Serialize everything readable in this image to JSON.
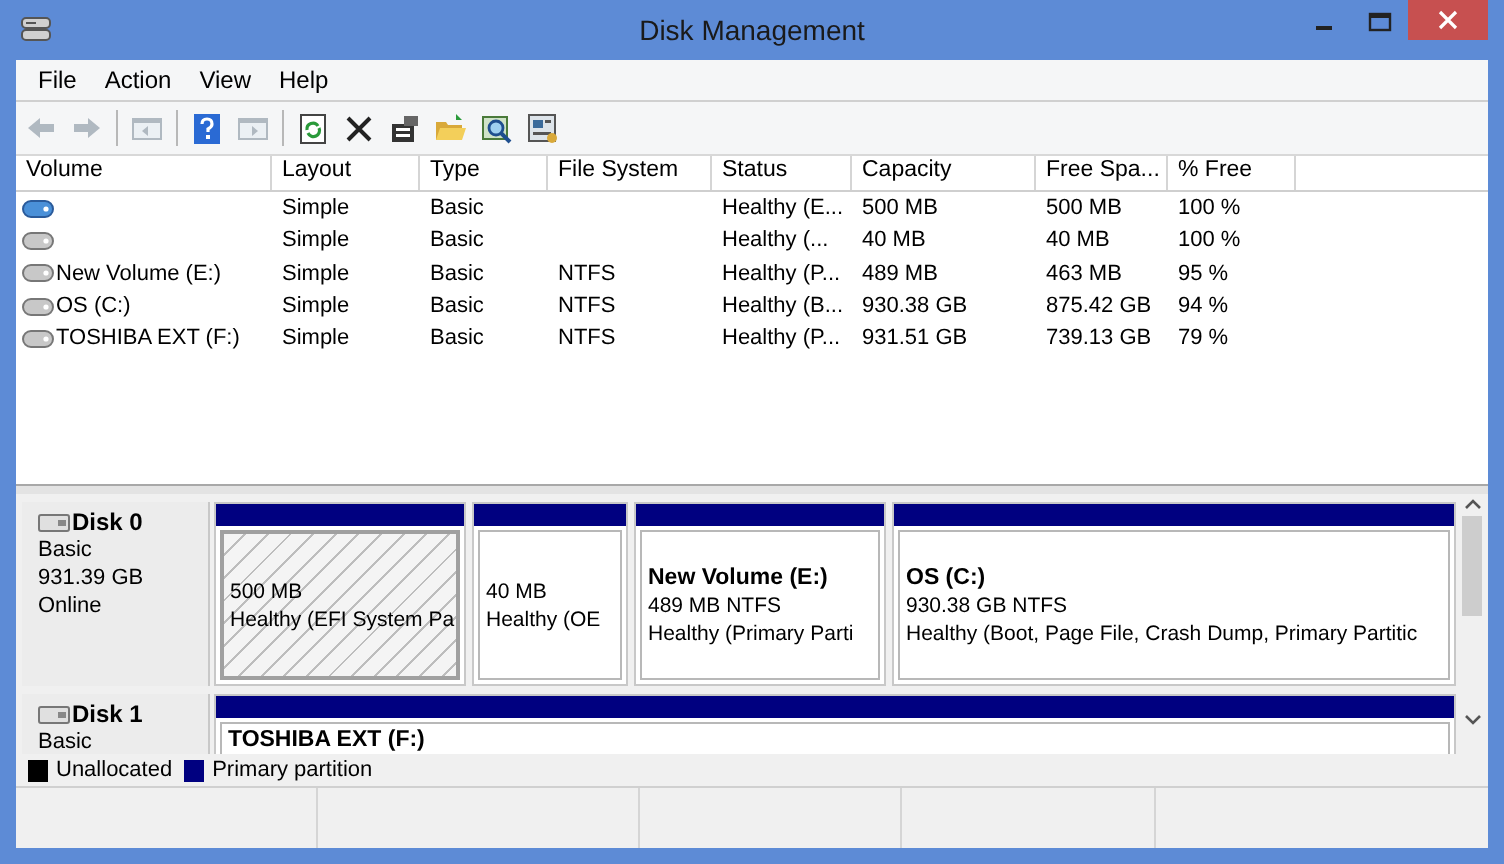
{
  "window": {
    "title": "Disk Management"
  },
  "menu": [
    "File",
    "Action",
    "View",
    "Help"
  ],
  "toolbar": [
    {
      "kind": "back",
      "disabled": true
    },
    {
      "kind": "forward",
      "disabled": true
    },
    {
      "kind": "sep"
    },
    {
      "kind": "tree",
      "disabled": true
    },
    {
      "kind": "sep"
    },
    {
      "kind": "help",
      "disabled": false
    },
    {
      "kind": "pane",
      "disabled": true
    },
    {
      "kind": "sep"
    },
    {
      "kind": "refresh",
      "disabled": false
    },
    {
      "kind": "delete",
      "disabled": false
    },
    {
      "kind": "properties",
      "disabled": false
    },
    {
      "kind": "open",
      "disabled": false
    },
    {
      "kind": "find",
      "disabled": false
    },
    {
      "kind": "settings",
      "disabled": false
    }
  ],
  "table": {
    "columns": [
      "Volume",
      "Layout",
      "Type",
      "File System",
      "Status",
      "Capacity",
      "Free Spa...",
      "% Free"
    ],
    "rows": [
      {
        "cells": [
          null,
          "Simple",
          "Basic",
          null,
          "Healthy (E...",
          "500 MB",
          "500 MB",
          "100 %"
        ]
      },
      {
        "cells": [
          null,
          "Simple",
          "Basic",
          null,
          "Healthy (...",
          "40 MB",
          "40 MB",
          "100 %"
        ]
      },
      {
        "cells": [
          "New Volume (E:)",
          "Simple",
          "Basic",
          "NTFS",
          "Healthy (P...",
          "489 MB",
          "463 MB",
          "95 %"
        ]
      },
      {
        "cells": [
          "OS (C:)",
          "Simple",
          "Basic",
          "NTFS",
          "Healthy (B...",
          "930.38 GB",
          "875.42 GB",
          "94 %"
        ]
      },
      {
        "cells": [
          "TOSHIBA EXT (F:)",
          "Simple",
          "Basic",
          "NTFS",
          "Healthy (P...",
          "931.51 GB",
          "739.13 GB",
          "79 %"
        ]
      }
    ]
  },
  "disks": [
    {
      "name": "Disk 0",
      "lines": [
        "Basic",
        "931.39 GB",
        "Online"
      ],
      "partitions": [
        {
          "selected": true,
          "lines": [
            "500 MB",
            "Healthy (EFI System Pa"
          ]
        },
        {
          "selected": false,
          "lines": [
            "40 MB",
            "Healthy (OE"
          ]
        },
        {
          "selected": false,
          "title": "New Volume  (E:)",
          "lines": [
            "489 MB NTFS",
            "Healthy (Primary Parti"
          ]
        },
        {
          "selected": false,
          "title": "OS  (C:)",
          "lines": [
            "930.38 GB NTFS",
            "Healthy (Boot, Page File, Crash Dump, Primary Partitic"
          ]
        }
      ]
    },
    {
      "name": "Disk 1",
      "lines": [
        "Basic"
      ],
      "partitions": [
        {
          "selected": false,
          "title": "TOSHIBA EXT  (F:)"
        }
      ]
    }
  ],
  "legend": [
    {
      "label": "Unallocated",
      "color": "#000000"
    },
    {
      "label": "Primary partition",
      "color": "#000080"
    }
  ]
}
